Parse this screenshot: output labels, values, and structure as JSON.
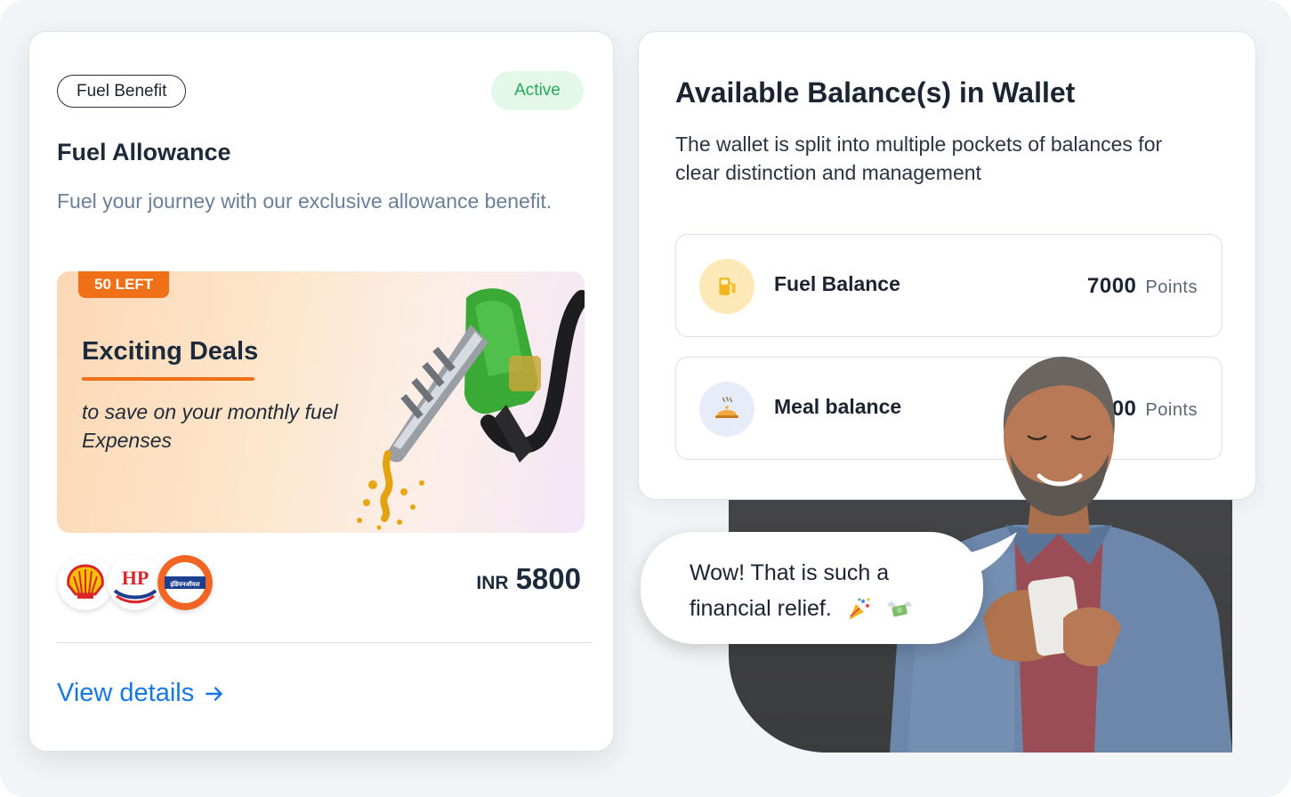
{
  "left_card": {
    "tag": "Fuel Benefit",
    "status": "Active",
    "title": "Fuel Allowance",
    "description": "Fuel your journey with our exclusive allowance benefit.",
    "banner": {
      "badge": "50 LEFT",
      "heading": "Exciting Deals",
      "subtext": "to save on your monthly fuel Expenses"
    },
    "brand_logos": [
      "shell-logo",
      "hp-logo",
      "indian-oil-logo"
    ],
    "hp_text": "HP",
    "indianoil_text": "इंडियनऑयल",
    "price": {
      "currency": "INR",
      "amount": "5800"
    },
    "link": "View details"
  },
  "wallet": {
    "title": "Available Balance(s) in Wallet",
    "description": "The wallet is split into multiple pockets of balances for clear distinction and management",
    "balances": [
      {
        "name": "Fuel Balance",
        "value": "7000",
        "unit": "Points",
        "icon": "fuel-pump-icon"
      },
      {
        "name": "Meal balance",
        "value": "00",
        "unit": "Points",
        "icon": "meal-cloche-icon"
      }
    ]
  },
  "bubble": {
    "line1": "Wow! That is such a",
    "line2": "financial relief.",
    "emojis": [
      "party-popper-icon",
      "money-with-wings-icon"
    ]
  },
  "colors": {
    "accent_orange": "#f07018",
    "link_blue": "#1677e0",
    "active_green": "#26a85a",
    "active_bg": "#e4f8ea"
  }
}
